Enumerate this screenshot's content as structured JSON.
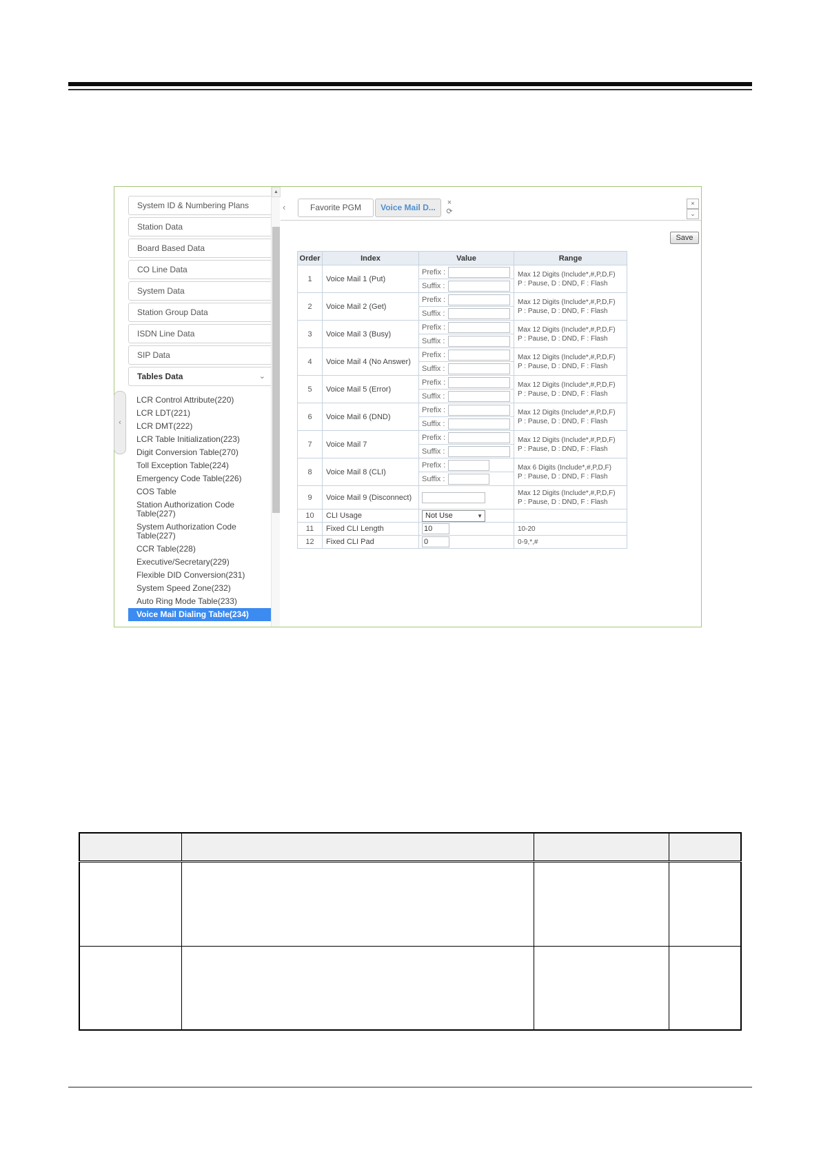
{
  "screenshot": {
    "sidebar": {
      "menu_items": [
        "System ID & Numbering Plans",
        "Station Data",
        "Board Based Data",
        "CO Line Data",
        "System Data",
        "Station Group Data",
        "ISDN Line Data",
        "SIP Data"
      ],
      "tables_section_label": "Tables Data",
      "table_links": [
        "LCR Control Attribute(220)",
        "LCR LDT(221)",
        "LCR DMT(222)",
        "LCR Table Initialization(223)",
        "Digit Conversion Table(270)",
        "Toll Exception Table(224)",
        "Emergency Code Table(226)",
        "COS Table",
        "Station Authorization Code Table(227)",
        "System Authorization Code Table(227)",
        "CCR Table(228)",
        "Executive/Secretary(229)",
        "Flexible DID Conversion(231)",
        "System Speed Zone(232)",
        "Auto Ring Mode Table(233)",
        "Voice Mail Dialing Table(234)"
      ],
      "selected_link": "Voice Mail Dialing Table(234)"
    },
    "tab_bar": {
      "tabs": [
        {
          "label": "Favorite PGM"
        },
        {
          "label": "Voice Mail D..."
        }
      ]
    },
    "icons": {
      "back_arrow": "‹",
      "tab_close": "×",
      "tab_refresh": "⟳",
      "window_close": "×",
      "window_scroll_down": "⌄",
      "scroll_up": "▲",
      "collapse_left": "‹",
      "section_chevron": "⌄",
      "select_arrow": "▼"
    },
    "save_button_label": "Save",
    "vm_table": {
      "headers": [
        "Order",
        "Index",
        "Value",
        "Range"
      ],
      "prefix_label": "Prefix :",
      "suffix_label": "Suffix :",
      "rows": [
        {
          "order": "1",
          "index": "Voice Mail 1 (Put)",
          "kind": "prefix_suffix",
          "value": "",
          "range": [
            "Max 12 Digits (Include*,#,P,D,F)",
            "P : Pause, D : DND, F : Flash"
          ]
        },
        {
          "order": "2",
          "index": "Voice Mail 2 (Get)",
          "kind": "prefix_suffix",
          "value": "",
          "range": [
            "Max 12 Digits (Include*,#,P,D,F)",
            "P : Pause, D : DND, F : Flash"
          ]
        },
        {
          "order": "3",
          "index": "Voice Mail 3 (Busy)",
          "kind": "prefix_suffix",
          "value": "",
          "range": [
            "Max 12 Digits (Include*,#,P,D,F)",
            "P : Pause, D : DND, F : Flash"
          ]
        },
        {
          "order": "4",
          "index": "Voice Mail 4 (No Answer)",
          "kind": "prefix_suffix",
          "value": "",
          "range": [
            "Max 12 Digits (Include*,#,P,D,F)",
            "P : Pause, D : DND, F : Flash"
          ]
        },
        {
          "order": "5",
          "index": "Voice Mail 5 (Error)",
          "kind": "prefix_suffix",
          "value": "",
          "range": [
            "Max 12 Digits (Include*,#,P,D,F)",
            "P : Pause, D : DND, F : Flash"
          ]
        },
        {
          "order": "6",
          "index": "Voice Mail 6 (DND)",
          "kind": "prefix_suffix",
          "value": "",
          "range": [
            "Max 12 Digits (Include*,#,P,D,F)",
            "P : Pause, D : DND, F : Flash"
          ]
        },
        {
          "order": "7",
          "index": "Voice Mail 7",
          "kind": "prefix_suffix",
          "value": "",
          "range": [
            "Max 12 Digits (Include*,#,P,D,F)",
            "P : Pause, D : DND, F : Flash"
          ]
        },
        {
          "order": "8",
          "index": "Voice Mail 8 (CLI)",
          "kind": "prefix_suffix_narrow",
          "value": "",
          "range": [
            "Max 6 Digits (Include*,#,P,D,F)",
            "P : Pause, D : DND, F : Flash"
          ]
        },
        {
          "order": "9",
          "index": "Voice Mail 9 (Disconnect)",
          "kind": "single_input",
          "value": "",
          "range": [
            "Max 12 Digits (Include*,#,P,D,F)",
            "P : Pause, D : DND, F : Flash"
          ]
        },
        {
          "order": "10",
          "index": "CLI Usage",
          "kind": "select",
          "value": "Not Use",
          "range": []
        },
        {
          "order": "11",
          "index": "Fixed CLI Length",
          "kind": "small_input",
          "value": "10",
          "range": [
            "10-20"
          ]
        },
        {
          "order": "12",
          "index": "Fixed CLI Pad",
          "kind": "small_input",
          "value": "0",
          "range": [
            "0-9,*,#"
          ]
        }
      ]
    },
    "colors": {
      "panel_border": "#a3c877",
      "selected_item_bg": "#3b8bf0",
      "active_tab_text": "#4e8fd0",
      "table_header_bg": "#e8edf3"
    }
  },
  "manual_table": {
    "column_count": 4,
    "body_row_count": 2
  }
}
